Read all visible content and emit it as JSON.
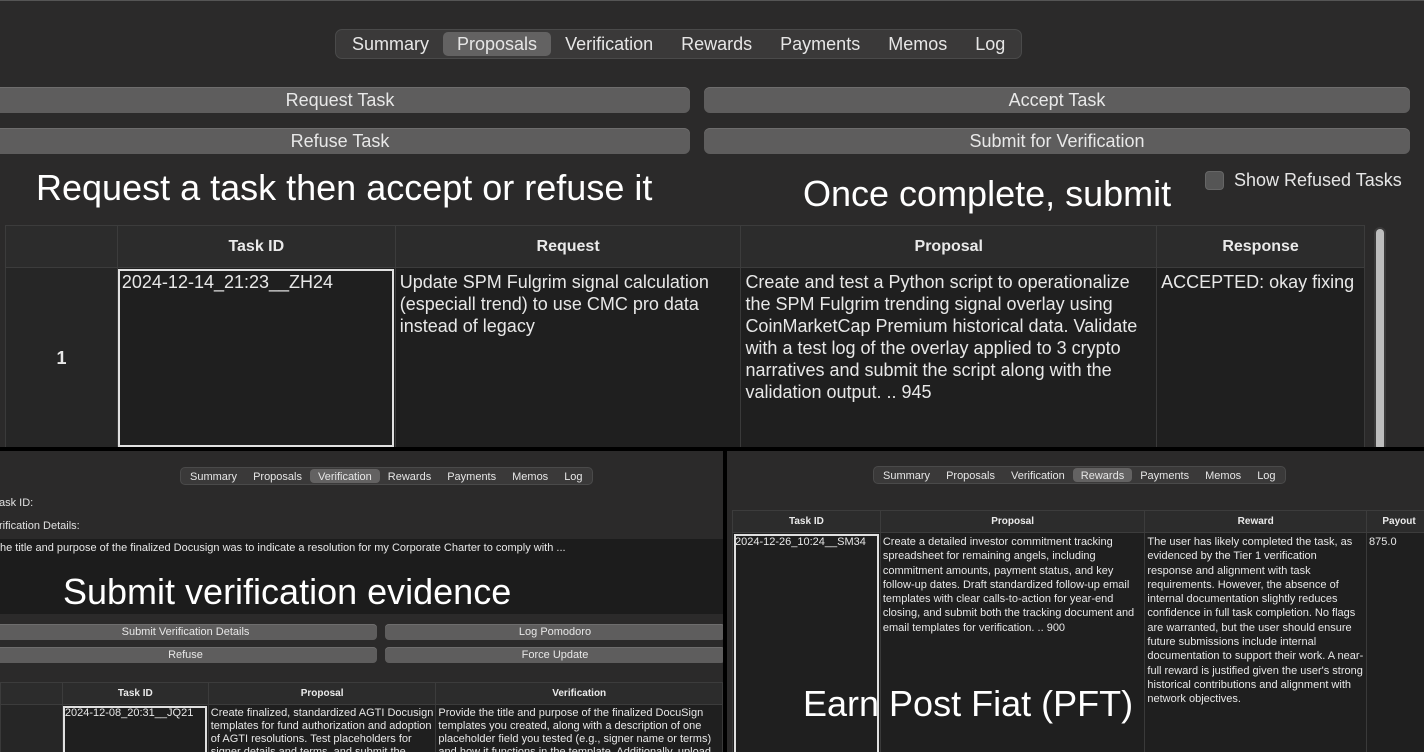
{
  "top": {
    "tabs": [
      "Summary",
      "Proposals",
      "Verification",
      "Rewards",
      "Payments",
      "Memos",
      "Log"
    ],
    "active_tab": "Proposals",
    "buttons": {
      "request": "Request Task",
      "accept": "Accept Task",
      "refuse": "Refuse Task",
      "submit": "Submit for Verification"
    },
    "caption_left": "Request a task then accept or refuse it",
    "caption_right": "Once complete, submit",
    "show_refused_label": "Show Refused Tasks",
    "table": {
      "headers": [
        "",
        "Task ID",
        "Request",
        "Proposal",
        "Response"
      ],
      "rows": [
        {
          "num": "1",
          "task_id": "2024-12-14_21:23__ZH24",
          "request": "Update SPM Fulgrim signal calculation (especiall trend) to use CMC pro data instead of legacy",
          "proposal": "Create and test a Python script to operationalize the SPM Fulgrim trending signal overlay using CoinMarketCap Premium historical data. Validate with a test log of the overlay applied to 3 crypto narratives and submit the script along with the validation output. .. 945",
          "response": "ACCEPTED: okay fixing"
        }
      ]
    }
  },
  "bottom_left": {
    "tabs": [
      "Summary",
      "Proposals",
      "Verification",
      "Rewards",
      "Payments",
      "Memos",
      "Log"
    ],
    "active_tab": "Verification",
    "task_id_label": "ask ID:",
    "details_label": "rification Details:",
    "details_text": "he title and purpose of the finalized Docusign was to indicate a resolution for my Corporate Charter to comply with ...",
    "caption": "Submit verification evidence",
    "buttons": {
      "submit_details": "Submit Verification Details",
      "log_pomodoro": "Log Pomodoro",
      "refuse": "Refuse",
      "force_update": "Force Update"
    },
    "table": {
      "headers": [
        "",
        "Task ID",
        "Proposal",
        "Verification"
      ],
      "rows": [
        {
          "task_id": "2024-12-08_20:31__JQ21",
          "proposal": "Create finalized, standardized AGTI Docusign templates for fund authorization and adoption of AGTI resolutions. Test placeholders for signer details and terms, and submit the",
          "verification": "Provide the title and purpose of the finalized DocuSign templates you created, along with a description of one placeholder field you tested (e.g., signer name or terms) and how it functions in the template. Additionally, upload the"
        }
      ]
    }
  },
  "bottom_right": {
    "tabs": [
      "Summary",
      "Proposals",
      "Verification",
      "Rewards",
      "Payments",
      "Memos",
      "Log"
    ],
    "active_tab": "Rewards",
    "caption": "Earn Post Fiat (PFT)",
    "table": {
      "headers": [
        "Task ID",
        "Proposal",
        "Reward",
        "Payout"
      ],
      "rows": [
        {
          "task_id": "2024-12-26_10:24__SM34",
          "proposal": "Create a detailed investor commitment tracking spreadsheet for remaining angels, including commitment amounts, payment status, and key follow-up dates. Draft standardized follow-up email templates with clear calls-to-action for year-end closing, and submit both the tracking document and email templates for verification. .. 900",
          "reward": "The user has likely completed the task, as evidenced by the Tier 1 verification response and alignment with task requirements. However, the absence of internal documentation slightly reduces confidence in full task completion. No flags are warranted, but the user should ensure future submissions include internal documentation to support their work. A near-full reward is justified given the user's strong historical contributions and alignment with network objectives.",
          "payout": "875.0"
        }
      ]
    }
  }
}
